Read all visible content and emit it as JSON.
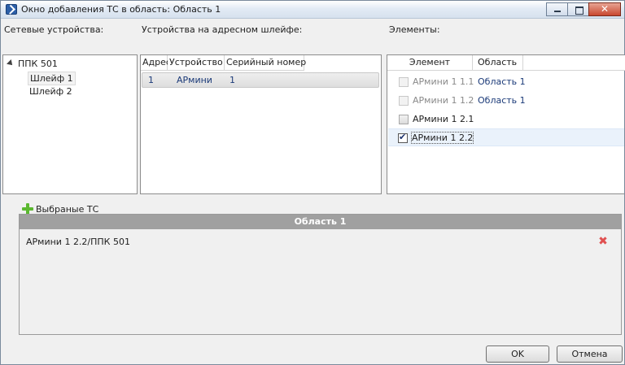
{
  "window": {
    "title": "Окно добавления ТС в область: Область 1"
  },
  "network": {
    "label": "Сетевые устройства:",
    "root": "ППК 501",
    "children": [
      "Шлейф 1",
      "Шлейф 2"
    ]
  },
  "loop_devices": {
    "label": "Устройства на адресном шлейфе:",
    "columns": [
      "Адрес",
      "Устройство",
      "Серийный номер"
    ],
    "rows": [
      {
        "address": "1",
        "device": "АРмини",
        "serial": "1"
      }
    ]
  },
  "elements": {
    "label": "Элементы:",
    "columns": [
      "Элемент",
      "Область"
    ],
    "rows": [
      {
        "name": "АРмини 1 1.1",
        "area": "Область 1",
        "state": "disabled"
      },
      {
        "name": "АРмини 1 1.2",
        "area": "Область 1",
        "state": "disabled"
      },
      {
        "name": "АРмини 1 2.1",
        "area": "",
        "state": "unchecked"
      },
      {
        "name": "АРмини 1 2.2",
        "area": "",
        "state": "checked"
      }
    ]
  },
  "selected": {
    "title": "Выбраные ТС",
    "group": "Область 1",
    "items": [
      "АРмини 1 2.2/ППК 501"
    ]
  },
  "buttons": {
    "ok": "OK",
    "cancel": "Отмена"
  },
  "colors": {
    "link_blue": "#1b3a78",
    "group_header": "#a0a0a0",
    "plus_green": "#5bb830"
  }
}
